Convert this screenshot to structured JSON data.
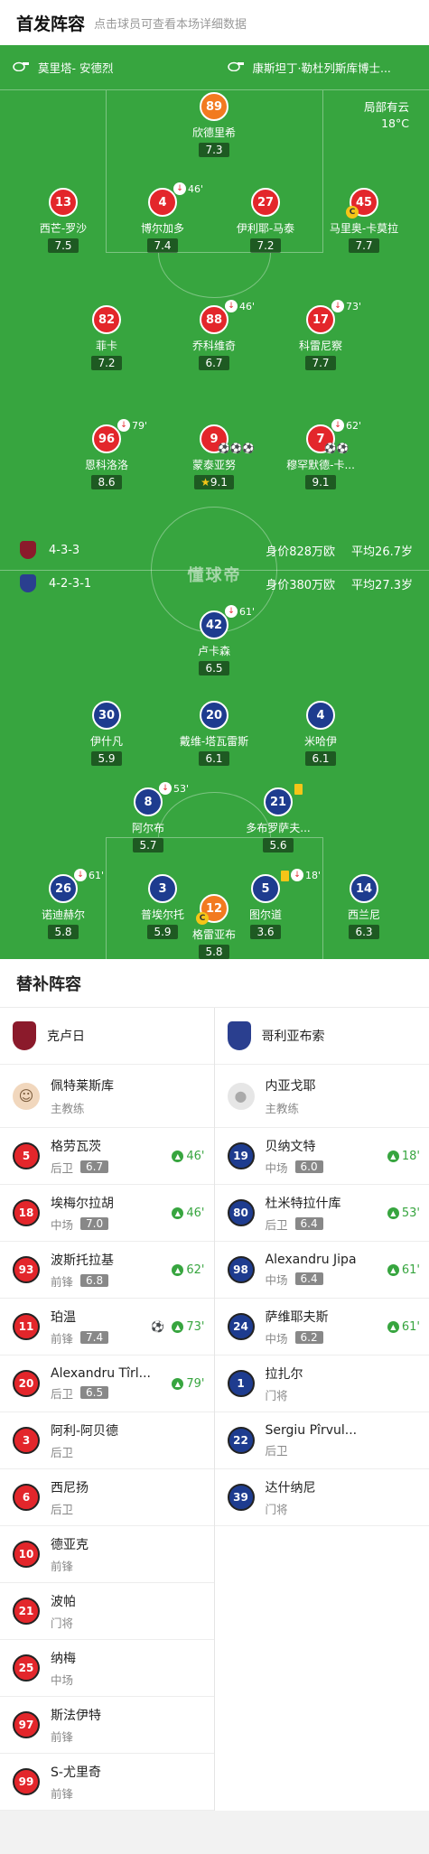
{
  "header": {
    "title": "首发阵容",
    "hint": "点击球员可查看本场详细数据"
  },
  "pitch": {
    "home_coach": "莫里塔- 安德烈",
    "away_coach": "康斯坦丁·勒杜列斯库博士...",
    "weather": {
      "condition": "局部有云",
      "temperature": "18°C"
    },
    "watermark": "懂球帝",
    "home_team": {
      "formation": "4-3-3",
      "value": "身价828万欧",
      "avg_age": "平均26.7岁",
      "color": "#8b1a2b"
    },
    "away_team": {
      "formation": "4-2-3-1",
      "value": "身价380万欧",
      "avg_age": "平均27.3岁",
      "color": "#2a3f8f"
    },
    "home_players": [
      {
        "number": "89",
        "name": "欣德里希",
        "rating": "7.3",
        "color": "orange"
      },
      {
        "number": "13",
        "name": "西芒-罗沙",
        "rating": "7.5",
        "color": "red"
      },
      {
        "number": "4",
        "name": "博尔加多",
        "rating": "7.4",
        "color": "red",
        "sub_time": "46'"
      },
      {
        "number": "27",
        "name": "伊利耶-马泰",
        "rating": "7.2",
        "color": "red"
      },
      {
        "number": "45",
        "name": "马里奥-卡莫拉",
        "rating": "7.7",
        "color": "red"
      },
      {
        "number": "82",
        "name": "菲卡",
        "rating": "7.2",
        "color": "red"
      },
      {
        "number": "88",
        "name": "乔科维奇",
        "rating": "6.7",
        "color": "red",
        "sub_time": "46'"
      },
      {
        "number": "17",
        "name": "科雷尼察",
        "rating": "7.7",
        "color": "red",
        "sub_time": "73'"
      },
      {
        "number": "96",
        "name": "恩科洛洛",
        "rating": "8.6",
        "color": "red",
        "sub_time": "79'"
      },
      {
        "number": "9",
        "name": "蒙泰亚努",
        "rating": "9.1",
        "color": "red",
        "balls": "⚽⚽⚽"
      },
      {
        "number": "7",
        "name": "穆罕默德-卡...",
        "rating": "9.1",
        "color": "red",
        "sub_time": "62'",
        "balls": "⚽⚽"
      }
    ],
    "away_players": [
      {
        "number": "42",
        "name": "卢卡森",
        "rating": "6.5",
        "color": "blue",
        "sub_time": "61'"
      },
      {
        "number": "30",
        "name": "伊什凡",
        "rating": "5.9",
        "color": "blue"
      },
      {
        "number": "20",
        "name": "戴维-塔瓦雷斯",
        "rating": "6.1",
        "color": "blue"
      },
      {
        "number": "4",
        "name": "米哈伊",
        "rating": "6.1",
        "color": "blue"
      },
      {
        "number": "8",
        "name": "阿尔布",
        "rating": "5.7",
        "color": "blue",
        "sub_time": "53'"
      },
      {
        "number": "21",
        "name": "多布罗萨夫...",
        "rating": "5.6",
        "color": "blue"
      },
      {
        "number": "26",
        "name": "诺迪赫尔",
        "rating": "5.8",
        "color": "blue",
        "sub_time": "61'"
      },
      {
        "number": "3",
        "name": "普埃尔托",
        "rating": "5.9",
        "color": "blue"
      },
      {
        "number": "5",
        "name": "图尔道",
        "rating": "3.6",
        "color": "blue",
        "sub_time": "18'"
      },
      {
        "number": "14",
        "name": "西兰尼",
        "rating": "6.3",
        "color": "blue"
      },
      {
        "number": "12",
        "name": "格雷亚布",
        "rating": "5.8",
        "color": "orange"
      }
    ]
  },
  "subs": {
    "title": "替补阵容",
    "home": {
      "team_name": "克卢日",
      "coach": {
        "name": "佩特莱斯库",
        "role": "主教练"
      },
      "players": [
        {
          "number": "5",
          "name": "格劳瓦茨",
          "position": "后卫",
          "rating": "6.7",
          "in_time": "46'"
        },
        {
          "number": "18",
          "name": "埃梅尔拉胡",
          "position": "中场",
          "rating": "7.0",
          "in_time": "46'"
        },
        {
          "number": "93",
          "name": "波斯托拉基",
          "position": "前锋",
          "rating": "6.8",
          "in_time": "62'"
        },
        {
          "number": "11",
          "name": "珀温",
          "position": "前锋",
          "rating": "7.4",
          "in_time": "73'",
          "goal": "⚽"
        },
        {
          "number": "20",
          "name": "Alexandru Tîrl...",
          "position": "后卫",
          "rating": "6.5",
          "in_time": "79'"
        },
        {
          "number": "3",
          "name": "阿利-阿贝德",
          "position": "后卫"
        },
        {
          "number": "6",
          "name": "西尼扬",
          "position": "后卫"
        },
        {
          "number": "10",
          "name": "德亚克",
          "position": "前锋"
        },
        {
          "number": "21",
          "name": "波帕",
          "position": "门将"
        },
        {
          "number": "25",
          "name": "纳梅",
          "position": "中场"
        },
        {
          "number": "97",
          "name": "斯法伊特",
          "position": "前锋"
        },
        {
          "number": "99",
          "name": "S-尤里奇",
          "position": "前锋"
        }
      ]
    },
    "away": {
      "team_name": "哥利亚布索",
      "coach": {
        "name": "内亚戈耶",
        "role": "主教练"
      },
      "players": [
        {
          "number": "19",
          "name": "贝纳文特",
          "position": "中场",
          "rating": "6.0",
          "in_time": "18'"
        },
        {
          "number": "80",
          "name": "杜米特拉什库",
          "position": "后卫",
          "rating": "6.4",
          "in_time": "53'"
        },
        {
          "number": "98",
          "name": "Alexandru Jipa",
          "position": "中场",
          "rating": "6.4",
          "in_time": "61'"
        },
        {
          "number": "24",
          "name": "萨维耶夫斯",
          "position": "中场",
          "rating": "6.2",
          "in_time": "61'"
        },
        {
          "number": "1",
          "name": "拉扎尔",
          "position": "门将"
        },
        {
          "number": "22",
          "name": "Sergiu Pîrvul...",
          "position": "后卫"
        },
        {
          "number": "39",
          "name": "达什纳尼",
          "position": "门将"
        }
      ]
    }
  }
}
